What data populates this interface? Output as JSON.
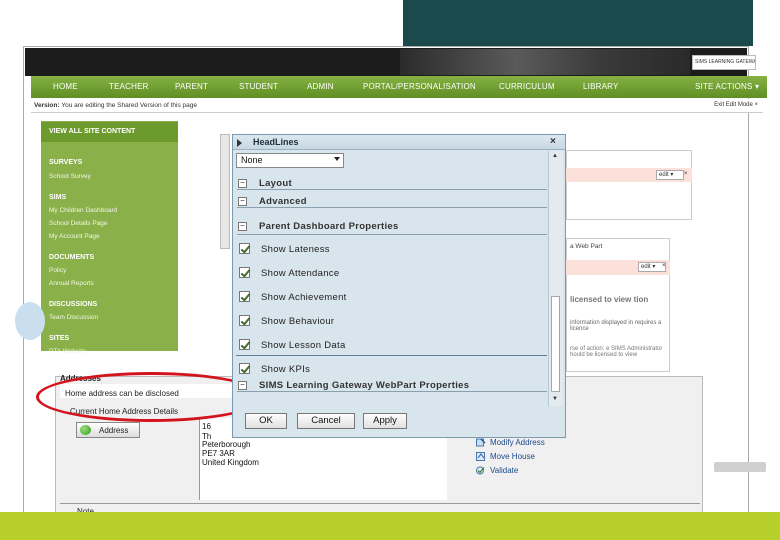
{
  "site": {
    "logo_text": "SIMS LEARNING GATEWAY",
    "nav_items": [
      "HOME",
      "TEACHER",
      "PARENT",
      "STUDENT",
      "ADMIN",
      "PORTAL/PERSONALISATION",
      "CURRICULUM",
      "LIBRARY"
    ],
    "site_actions": "SITE ACTIONS ▾",
    "version_label": "Version:",
    "version_text": "You are editing the Shared Version of this page",
    "edit_mode": "Exit Edit Mode ×"
  },
  "sidebar": {
    "header": "VIEW ALL SITE CONTENT",
    "sections": [
      {
        "heading": "SURVEYS",
        "items": [
          "School Survey"
        ]
      },
      {
        "heading": "SIMS",
        "items": [
          "My Children Dashboard",
          "School Details Page",
          "My Account Page"
        ]
      },
      {
        "heading": "DOCUMENTS",
        "items": [
          "Policy",
          "Annual Reports"
        ]
      },
      {
        "heading": "DISCUSSIONS",
        "items": [
          "Team Discussion"
        ]
      },
      {
        "heading": "SITES",
        "items": [
          "PTA Website"
        ]
      }
    ]
  },
  "right_panel": {
    "edit_label_1": "edit ▾",
    "edit_label_2": "edit ▾",
    "close_1": "×",
    "close_2": "×",
    "web_part_text": "a Web Part",
    "warning_title": "licensed to view tion",
    "warning_body": "information displayed in requires a licence",
    "warning_note": "rse of action: e SIMS Administrator hould be licensed to view"
  },
  "dialog": {
    "title": "HeadLines",
    "close": "×",
    "select_value": "None",
    "sections": [
      "Layout",
      "Advanced",
      "Parent Dashboard Properties",
      "SIMS Learning Gateway WebPart Properties"
    ],
    "section_toggle": "−",
    "checkboxes": [
      {
        "label": "Show Lateness",
        "checked": true
      },
      {
        "label": "Show Attendance",
        "checked": true
      },
      {
        "label": "Show Achievement",
        "checked": true
      },
      {
        "label": "Show Behaviour",
        "checked": true
      },
      {
        "label": "Show Lesson Data",
        "checked": true
      },
      {
        "label": "Show KPIs",
        "checked": true
      }
    ],
    "buttons": {
      "ok": "OK",
      "cancel": "Cancel",
      "apply": "Apply"
    },
    "scroll_up": "▲",
    "scroll_down": "▼"
  },
  "address_form": {
    "section_label": "Addresses",
    "disclosed": "Home address can be disclosed",
    "current": "Current Home Address Details",
    "address_button": "Address",
    "address_lines": [
      "16",
      "Th",
      "Peterborough",
      "PE7 3AR",
      "United Kingdom"
    ],
    "actions": [
      "Modify Address",
      "Move House",
      "Validate"
    ],
    "note_label": "Note"
  },
  "colors": {
    "nav_green": "#6d9a2c",
    "sidebar_green": "#8ab04a",
    "bottom_bar": "#b6cf2a",
    "banner": "#1b4a4c",
    "highlight_red": "#d3141c",
    "dialog_bg": "#d9e5ec"
  }
}
